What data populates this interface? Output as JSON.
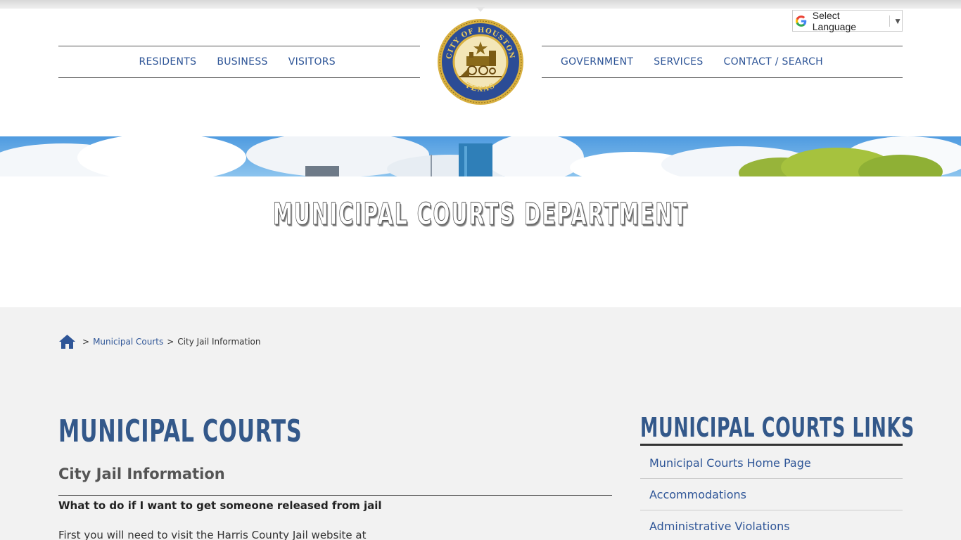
{
  "language": {
    "label": "Select Language",
    "arrow": "▼"
  },
  "nav": {
    "left": [
      "RESIDENTS",
      "BUSINESS",
      "VISITORS"
    ],
    "right": [
      "GOVERNMENT",
      "SERVICES",
      "CONTACT / SEARCH"
    ]
  },
  "seal": {
    "top_text": "CITY OF HOUSTON",
    "bottom_text": "TEXAS"
  },
  "hero": {
    "title": "MUNICIPAL COURTS DEPARTMENT"
  },
  "breadcrumb": {
    "sep": ">",
    "link": "Municipal Courts",
    "current": "City Jail Information"
  },
  "content": {
    "title": "MUNICIPAL COURTS",
    "subtitle": "City Jail Information",
    "question": "What to do if I want to get someone released from jail",
    "paragraph": "First you will need to visit the Harris County Jail website at"
  },
  "sidebar": {
    "title": "MUNICIPAL COURTS LINKS",
    "links": [
      "Municipal Courts Home Page",
      "Accommodations",
      "Administrative Violations"
    ]
  },
  "colors": {
    "link": "#2e5597",
    "heading": "#33588a",
    "background": "#f2f2f2",
    "seal_blue": "#2b4c96",
    "seal_gold": "#d8b040"
  }
}
